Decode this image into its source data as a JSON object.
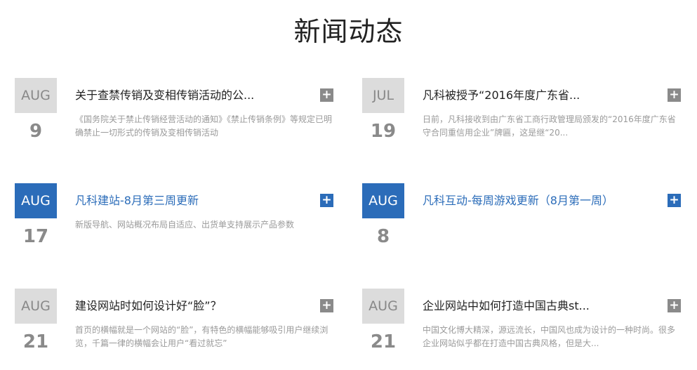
{
  "section_title": "新闻动态",
  "colors": {
    "accent": "#2b6cb9",
    "muted_box": "#dcdcdc",
    "muted_text": "#8a8a8a"
  },
  "news": [
    {
      "month": "AUG",
      "day": "9",
      "title": "关于查禁传销及变相传销活动的公...",
      "excerpt": "《国务院关于禁止传销经营活动的通知》《禁止传销条例》等规定已明确禁止一切形式的传销及变相传销活动",
      "expand_icon": "plus-icon"
    },
    {
      "month": "JUL",
      "day": "19",
      "title": "凡科被授予“2016年度广东省...",
      "excerpt": "日前，凡科接收到由广东省工商行政管理局颁发的“2016年度广东省守合同重信用企业”牌匾，这是继“20...",
      "expand_icon": "plus-icon"
    },
    {
      "month": "AUG",
      "day": "17",
      "title": "凡科建站-8月第三周更新",
      "excerpt": "新版导航、网站概况布局自适应、出货单支持展示产品参数",
      "expand_icon": "plus-icon"
    },
    {
      "month": "AUG",
      "day": "8",
      "title": "凡科互动-每周游戏更新（8月第一周）",
      "excerpt": "",
      "expand_icon": "plus-icon"
    },
    {
      "month": "AUG",
      "day": "21",
      "title": "建设网站时如何设计好“脸”？",
      "excerpt": "首页的横幅就是一个网站的“脸”，有特色的横幅能够吸引用户继续浏览，千篇一律的横幅会让用户“看过就忘”",
      "expand_icon": "plus-icon"
    },
    {
      "month": "AUG",
      "day": "21",
      "title": "企业网站中如何打造中国古典st...",
      "excerpt": "中国文化博大精深，源远流长，中国风也成为设计的一种时尚。很多企业网站似乎都在打造中国古典风格，但是大...",
      "expand_icon": "plus-icon"
    }
  ]
}
